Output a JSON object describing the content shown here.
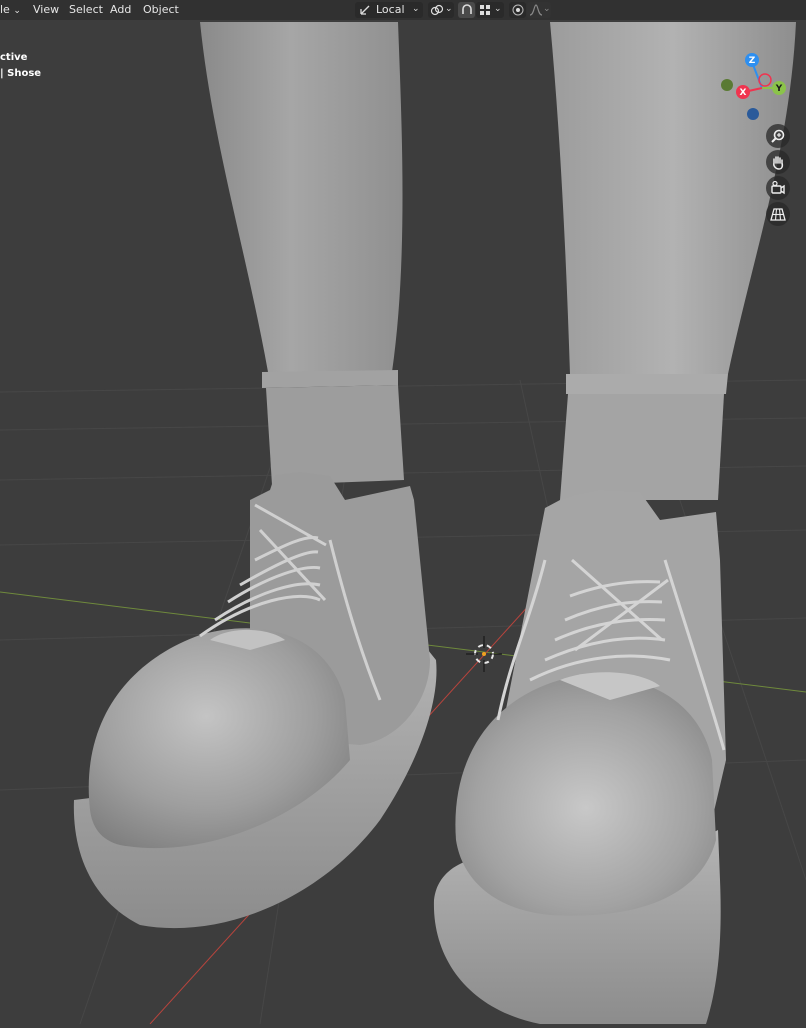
{
  "header": {
    "mode_partial": "le",
    "menus": [
      "View",
      "Select",
      "Add",
      "Object"
    ],
    "orientation": "Local",
    "icons": [
      "transform-pivot-icon",
      "link-icon",
      "snap-icon",
      "snap-increment-icon",
      "proportional-editing-icon",
      "falloff-icon"
    ]
  },
  "overlay": {
    "mode_line": "ctive",
    "object_line": "| Shose"
  },
  "gizmo": {
    "z": "Z",
    "x": "X",
    "y": "Y",
    "colors": {
      "x": "#f0344f",
      "y": "#8bc34a",
      "z": "#2e8ff0",
      "neg_y": "#5a7a33",
      "neg_z": "#2a5a9a"
    }
  },
  "navigation": [
    "zoom-icon",
    "pan-hand-icon",
    "camera-view-icon",
    "grid-ortho-icon"
  ],
  "scene": {
    "object": "Shose",
    "colors": {
      "background": "#3d3d3d",
      "x_axis": "#b8443d",
      "y_axis": "#6f8a3c",
      "mesh": "#a8a8a8"
    }
  }
}
